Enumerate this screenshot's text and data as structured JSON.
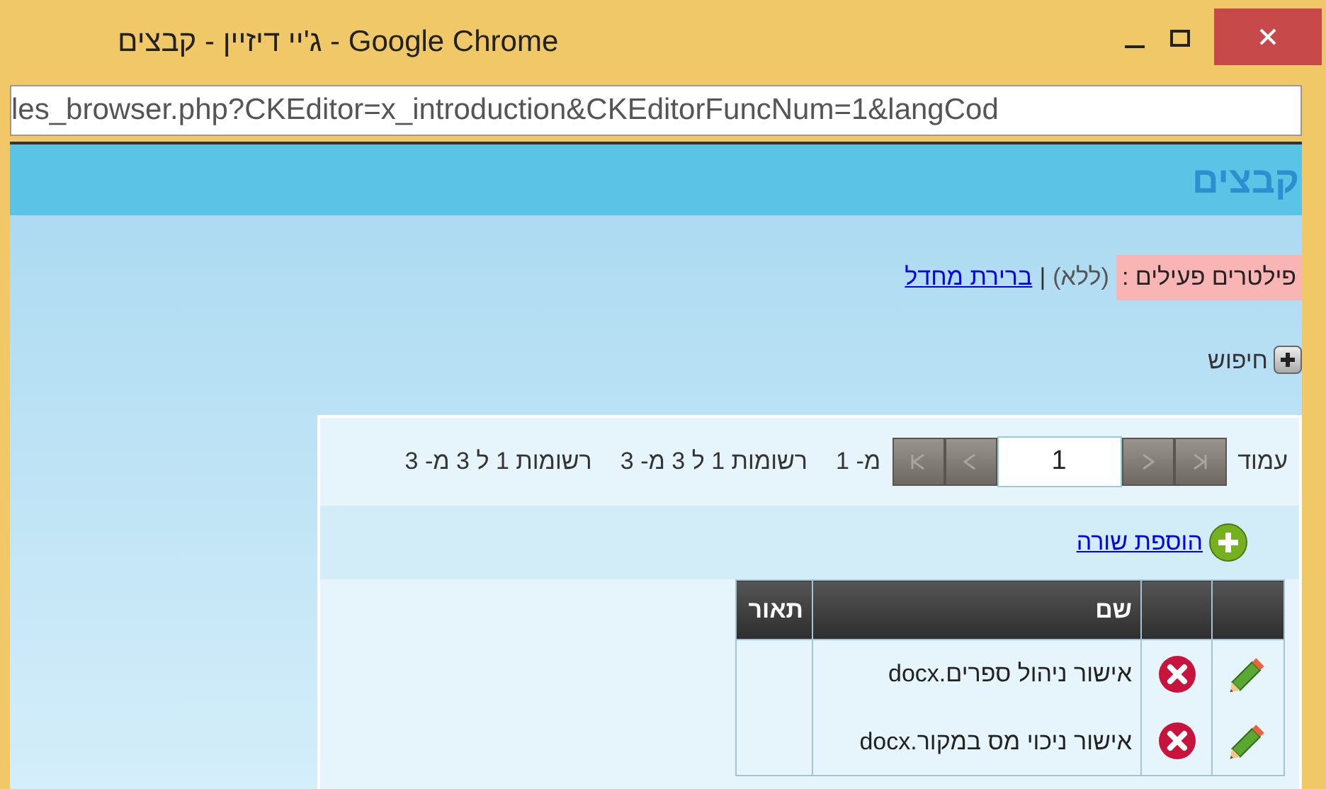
{
  "window": {
    "title": "ג'יי דיזיין - קבצים - Google Chrome"
  },
  "address_bar": {
    "value": "les_browser.php?CKEditor=x_introduction&CKEditorFuncNum=1&langCod"
  },
  "page": {
    "heading": "קבצים",
    "filters": {
      "label": "פילטרים פעילים :",
      "value": "(ללא)",
      "separator": "|",
      "reset_link": "ברירת מחדל"
    },
    "search_toggle": {
      "label": "חיפוש"
    },
    "pager": {
      "page_label": "עמוד",
      "page_value": "1",
      "page_count": "מ- 1",
      "records": [
        "רשומות 1 ל 3 מ- 3",
        "רשומות 1 ל 3 מ- 3"
      ]
    },
    "add_row_link": "הוספת שורה",
    "table": {
      "columns": [
        "",
        "",
        "שם",
        "תאור"
      ],
      "rows": [
        {
          "name": "אישור ניהול ספרים.docx",
          "description": ""
        },
        {
          "name": "אישור ניכוי מס במקור.docx",
          "description": ""
        }
      ]
    }
  }
}
